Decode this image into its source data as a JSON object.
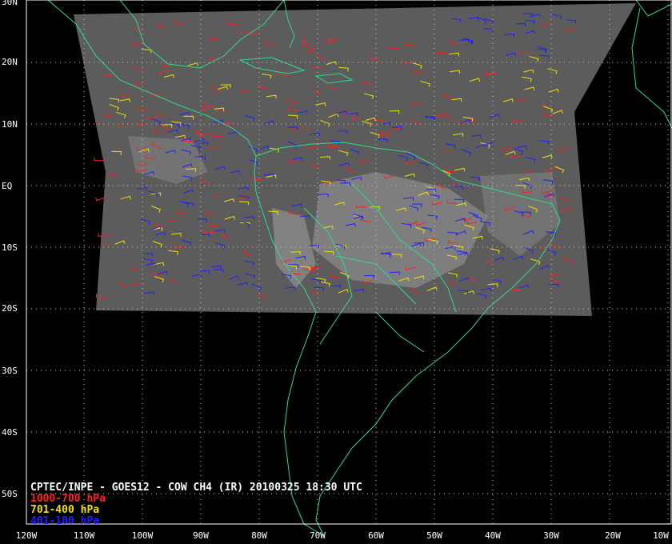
{
  "caption": "CPTEC/INPE - GOES12 - COW CH4 (IR) 20100325 18:30 UTC",
  "legend": [
    {
      "label": "1000-700 hPa",
      "color": "#ff2020"
    },
    {
      "label": "701-400 hPa",
      "color": "#f0e000"
    },
    {
      "label": "401-100 hPa",
      "color": "#2020ff"
    }
  ],
  "lat_labels": [
    "30N",
    "20N",
    "10N",
    "EQ",
    "10S",
    "20S",
    "30S",
    "40S",
    "50S"
  ],
  "lon_labels": [
    "120W",
    "110W",
    "100W",
    "90W",
    "80W",
    "70W",
    "60W",
    "50W",
    "40W",
    "30W",
    "20W",
    "10W"
  ],
  "colors": {
    "background": "#000000",
    "grid": "#c8c8c8",
    "coastline": "#30d890",
    "satellite": "#5a5a5a"
  }
}
